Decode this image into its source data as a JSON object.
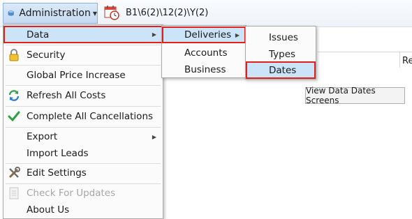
{
  "toolbar": {
    "admin_label": "Administration",
    "path_text": "B1\\6(2)\\12(2)\\Y(2)"
  },
  "background": {
    "column_label": "Re",
    "button_label": "View Data Dates Screens"
  },
  "main_menu": {
    "items": [
      {
        "label": "Data",
        "icon": "none",
        "submenu": true
      },
      {
        "label": "Security",
        "icon": "lock-icon"
      },
      {
        "label": "Global Price Increase",
        "icon": "none"
      },
      {
        "label": "Refresh All Costs",
        "icon": "refresh-icon"
      },
      {
        "label": "Complete All Cancellations",
        "icon": "checkmark-icon"
      },
      {
        "label": "Export",
        "icon": "none",
        "submenu": true
      },
      {
        "label": "Import Leads",
        "icon": "none"
      },
      {
        "label": "Edit Settings",
        "icon": "tools-icon"
      },
      {
        "label": "Check For Updates",
        "icon": "update-icon",
        "disabled": true
      },
      {
        "label": "About Us",
        "icon": "none"
      }
    ]
  },
  "data_menu": {
    "items": [
      {
        "label": "Deliveries",
        "submenu": true
      },
      {
        "label": "Accounts"
      },
      {
        "label": "Business"
      }
    ]
  },
  "deliveries_menu": {
    "items": [
      {
        "label": "Issues"
      },
      {
        "label": "Types"
      },
      {
        "label": "Dates"
      }
    ]
  },
  "colors": {
    "highlight": "#cce4f7",
    "annotation_red": "#e0201b"
  }
}
